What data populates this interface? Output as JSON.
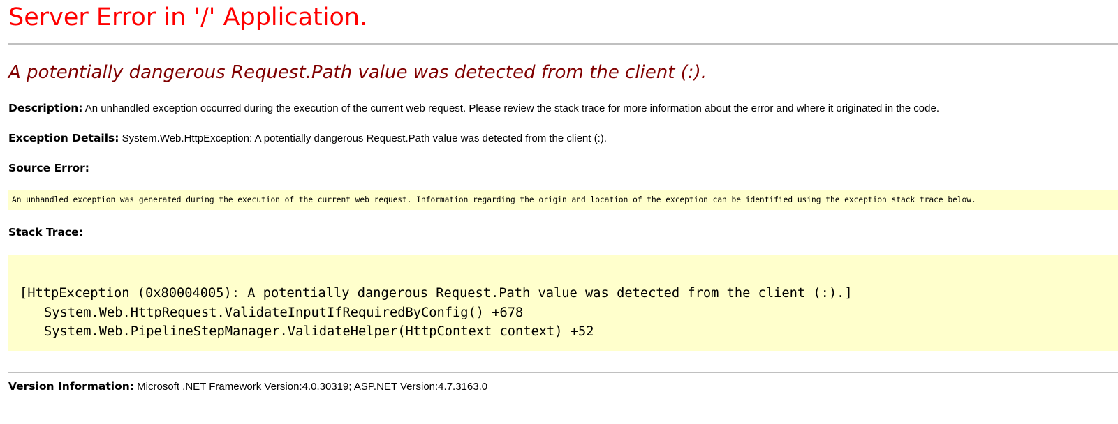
{
  "page": {
    "title": "Server Error in '/' Application.",
    "error_heading": "A potentially dangerous Request.Path value was detected from the client (:)."
  },
  "description": {
    "label": "Description:",
    "text": " An unhandled exception occurred during the execution of the current web request. Please review the stack trace for more information about the error and where it originated in the code."
  },
  "exception_details": {
    "label": "Exception Details:",
    "text": " System.Web.HttpException: A potentially dangerous Request.Path value was detected from the client (:)."
  },
  "source_error": {
    "label": "Source Error:",
    "text": "An unhandled exception was generated during the execution of the current web request. Information regarding the origin and location of the exception can be identified using the exception stack trace below."
  },
  "stack_trace": {
    "label": "Stack Trace:",
    "lines": [
      "[HttpException (0x80004005): A potentially dangerous Request.Path value was detected from the client (:).]",
      "System.Web.HttpRequest.ValidateInputIfRequiredByConfig() +678",
      "System.Web.PipelineStepManager.ValidateHelper(HttpContext context) +52"
    ]
  },
  "version_information": {
    "label": "Version Information:",
    "text": " Microsoft .NET Framework Version:4.0.30319; ASP.NET Version:4.7.3163.0"
  },
  "colors": {
    "title": "#ff0000",
    "error_heading": "#800000",
    "code_background": "#ffffcc",
    "rule": "#c0c0c0"
  }
}
